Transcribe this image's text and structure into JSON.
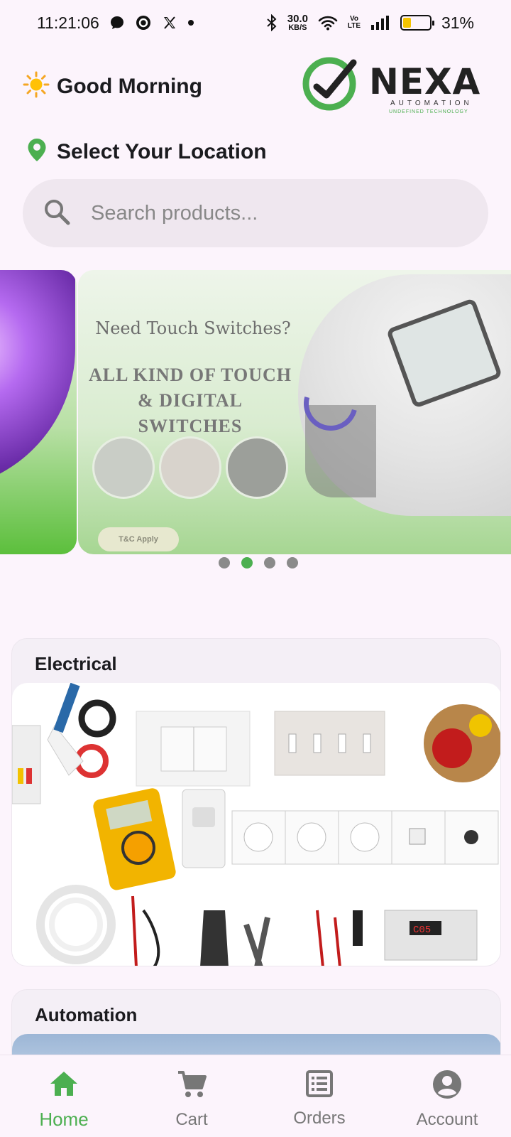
{
  "status_bar": {
    "time": "11:21:06",
    "net_speed_value": "30.0",
    "net_speed_unit": "KB/S",
    "volte": "Vo LTE",
    "battery_percent": "31%",
    "battery_level": 0.31,
    "battery_color": "#f5c400"
  },
  "header": {
    "greeting": "Good Morning",
    "greeting_icon": "sun-icon",
    "logo": {
      "brand": "NEXA",
      "tagline": "AUTOMATION",
      "subtagline": "UNDEFINED TECHNOLOGY",
      "accent": "#4caf50"
    }
  },
  "location": {
    "label": "Select Your Location",
    "icon": "location-pin-icon"
  },
  "search": {
    "placeholder": "Search products...",
    "value": ""
  },
  "carousel": {
    "slide": {
      "headline": "Need Touch Switches?",
      "subline_1": "ALL KIND OF TOUCH",
      "subline_2": "& DIGITAL SWITCHES",
      "badge": "T&C Apply"
    },
    "page_count": 4,
    "active_index": 1
  },
  "categories": [
    {
      "title": "Electrical"
    },
    {
      "title": "Automation"
    }
  ],
  "bottom_nav": {
    "items": [
      {
        "label": "Home",
        "icon": "home-icon",
        "active": true
      },
      {
        "label": "Cart",
        "icon": "cart-icon",
        "active": false
      },
      {
        "label": "Orders",
        "icon": "orders-icon",
        "active": false
      },
      {
        "label": "Account",
        "icon": "account-icon",
        "active": false
      }
    ],
    "active_color": "#4caf50",
    "inactive_color": "#777777"
  }
}
